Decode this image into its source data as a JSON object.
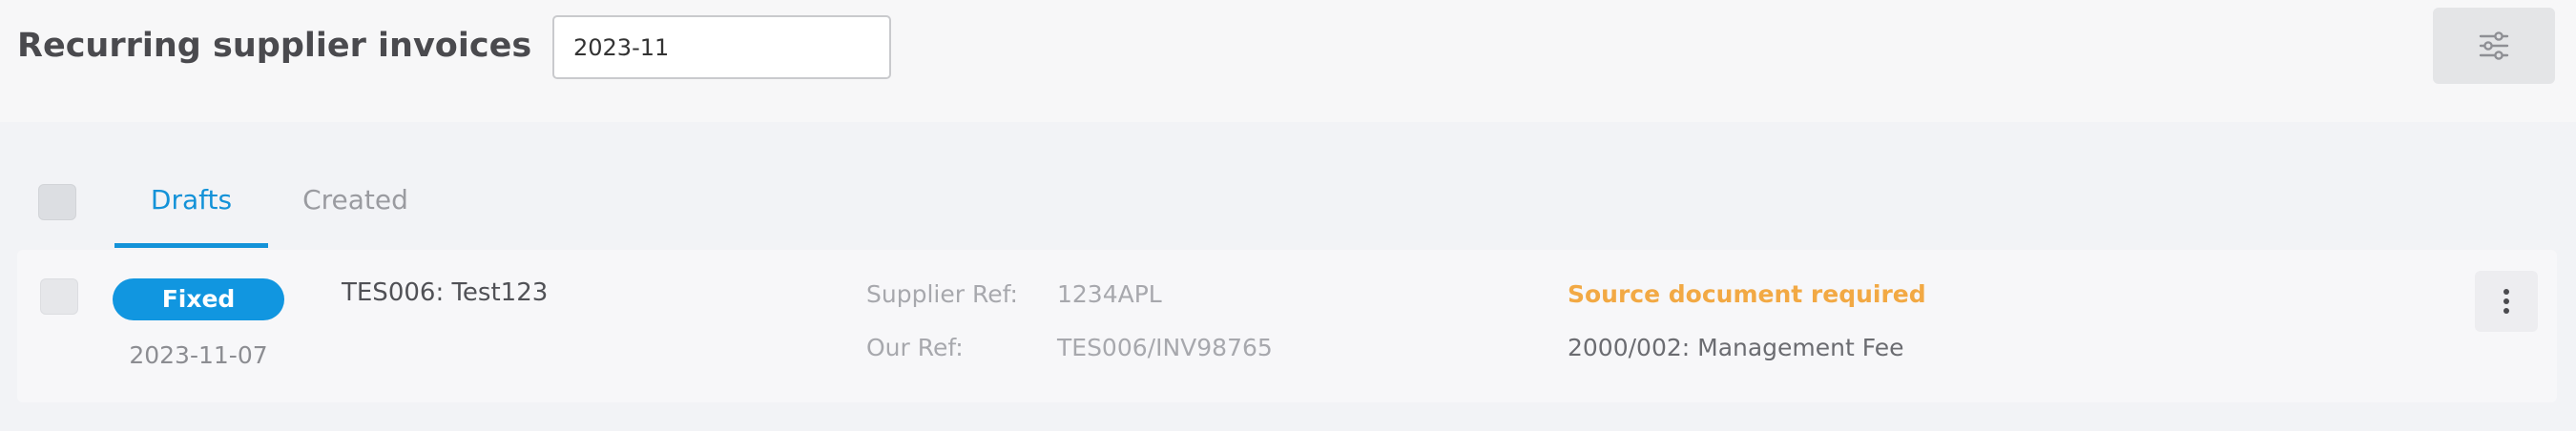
{
  "header": {
    "title": "Recurring supplier invoices",
    "period_value": "2023-11",
    "filter_icon": "sliders-icon"
  },
  "tabs": [
    {
      "label": "Drafts",
      "active": true
    },
    {
      "label": "Created",
      "active": false
    }
  ],
  "invoices": [
    {
      "type": "Fixed",
      "date": "2023-11-07",
      "name": "TES006: Test123",
      "supplier_ref_label": "Supplier Ref:",
      "supplier_ref": "1234APL",
      "our_ref_label": "Our Ref:",
      "our_ref": "TES006/INV98765",
      "warning": "Source document required",
      "account": "2000/002: Management Fee",
      "menu_icon": "more-vertical-icon"
    }
  ],
  "colors": {
    "accent": "#1392d8",
    "badge": "#1196e0",
    "warning": "#f2a944",
    "header_bg": "#f7f7f8",
    "page_bg": "#f2f3f6"
  }
}
